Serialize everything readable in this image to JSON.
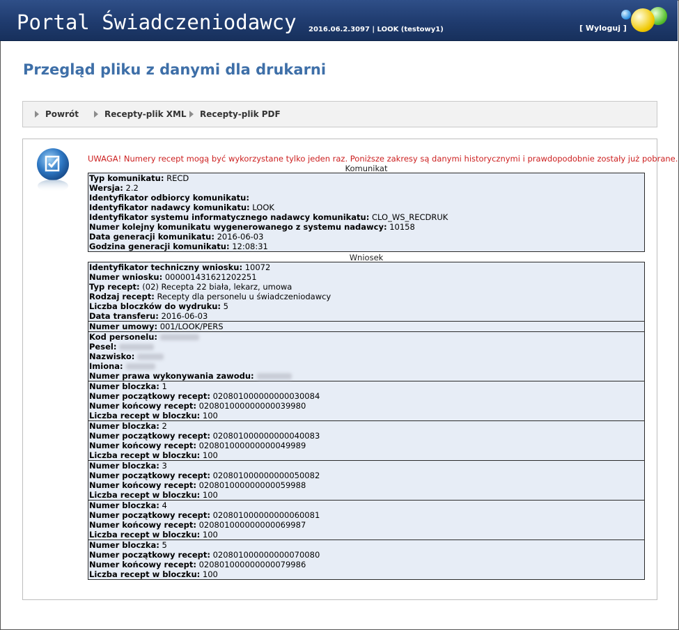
{
  "header": {
    "title": "Portal Świadczeniodawcy",
    "version": "2016.06.2.3097 | LOOK (testowy1)",
    "logout": "[ Wyloguj ]"
  },
  "page": {
    "title": "Przegląd pliku z danymi dla drukarni"
  },
  "toolbar": {
    "items": [
      "Powrót",
      "Recepty-plik XML",
      "Recepty-plik PDF"
    ]
  },
  "content": {
    "warning": "UWAGA! Numery recept mogą być wykorzystane tylko jeden raz. Poniższe zakresy są danymi historycznymi i prawdopodobnie zostały już pobrane.",
    "komunikat": {
      "label": "Komunikat",
      "rows": [
        {
          "k": "Typ komunikatu:",
          "v": "RECD"
        },
        {
          "k": "Wersja:",
          "v": "2.2"
        },
        {
          "k": "Identyfikator odbiorcy komunikatu:",
          "v": ""
        },
        {
          "k": "Identyfikator nadawcy komunikatu:",
          "v": "LOOK"
        },
        {
          "k": "Identyfikator systemu informatycznego nadawcy komunikatu:",
          "v": "CLO_WS_RECDRUK"
        },
        {
          "k": "Numer kolejny komunikatu wygenerowanego z systemu nadawcy:",
          "v": "10158"
        },
        {
          "k": "Data generacji komunikatu:",
          "v": "2016-06-03"
        },
        {
          "k": "Godzina generacji komunikatu:",
          "v": "12:08:31"
        }
      ]
    },
    "wniosek": {
      "label": "Wniosek",
      "rows": [
        {
          "k": "Identyfikator techniczny wniosku:",
          "v": "10072"
        },
        {
          "k": "Numer wniosku:",
          "v": "000001431621202251"
        },
        {
          "k": "Typ recept:",
          "v": "(02) Recepta 22 biała, lekarz, umowa"
        },
        {
          "k": "Rodzaj recept:",
          "v": "Recepty dla personelu u świadczeniodawcy"
        },
        {
          "k": "Liczba bloczków do wydruku:",
          "v": "5"
        },
        {
          "k": "Data transferu:",
          "v": "2016-06-03"
        }
      ],
      "umowa": {
        "k": "Numer umowy:",
        "v": "001/LOOK/PERS"
      },
      "personel": [
        {
          "k": "Kod personelu:"
        },
        {
          "k": "Pesel:"
        },
        {
          "k": "Nazwisko:"
        },
        {
          "k": "Imiona:"
        },
        {
          "k": "Numer prawa wykonywania zawodu:"
        }
      ],
      "bloczki": [
        {
          "nr": "1",
          "start": "020801000000000030084",
          "end": "020801000000000039980",
          "count": "100"
        },
        {
          "nr": "2",
          "start": "020801000000000040083",
          "end": "020801000000000049989",
          "count": "100"
        },
        {
          "nr": "3",
          "start": "020801000000000050082",
          "end": "020801000000000059988",
          "count": "100"
        },
        {
          "nr": "4",
          "start": "020801000000000060081",
          "end": "020801000000000069987",
          "count": "100"
        },
        {
          "nr": "5",
          "start": "020801000000000070080",
          "end": "020801000000000079986",
          "count": "100"
        }
      ],
      "bloczek_labels": {
        "nr": "Numer bloczka:",
        "start": "Numer początkowy recept:",
        "end": "Numer końcowy recept:",
        "count": "Liczba recept w bloczku:"
      }
    }
  },
  "colors": {
    "header_bg": "#1f3b6e",
    "title": "#3e6fa8",
    "warning": "#cc1f1f",
    "box_bg": "#e7edf6"
  },
  "icons": [
    "info-document-icon",
    "logo-balls-icon",
    "arrow-right-icon"
  ]
}
